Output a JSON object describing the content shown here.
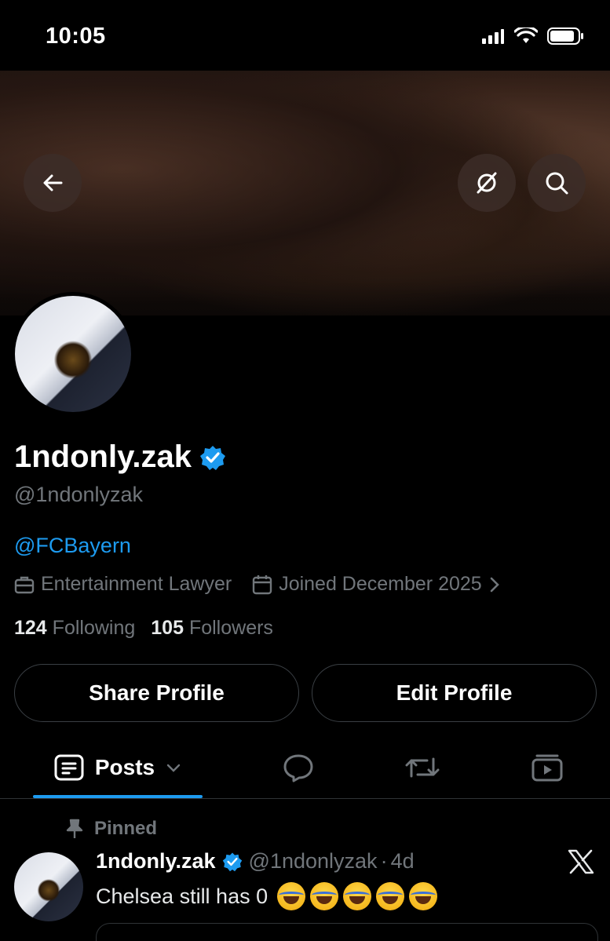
{
  "status": {
    "time": "10:05"
  },
  "profile": {
    "display_name": "1ndonly.zak",
    "handle": "@1ndonlyzak",
    "bio_link": "@FCBayern",
    "occupation": "Entertainment Lawyer",
    "joined": "Joined December 2025",
    "following_count": "124",
    "following_label": "Following",
    "followers_count": "105",
    "followers_label": "Followers"
  },
  "buttons": {
    "share": "Share Profile",
    "edit": "Edit Profile"
  },
  "tabs": {
    "posts": "Posts"
  },
  "pinned_post": {
    "pinned_label": "Pinned",
    "name": "1ndonly.zak",
    "handle": "@1ndonlyzak",
    "separator": "·",
    "age": "4d",
    "text": "Chelsea still has 0",
    "emoji_count": 5
  },
  "colors": {
    "accent": "#1d9bf0",
    "muted": "#71767b",
    "background": "#000000"
  },
  "icons": [
    "back-arrow-icon",
    "grok-icon",
    "search-icon",
    "briefcase-icon",
    "calendar-icon",
    "chevron-right-icon",
    "posts-icon",
    "reply-icon",
    "repost-icon",
    "video-icon",
    "pin-icon",
    "verified-icon",
    "x-logo-icon"
  ]
}
